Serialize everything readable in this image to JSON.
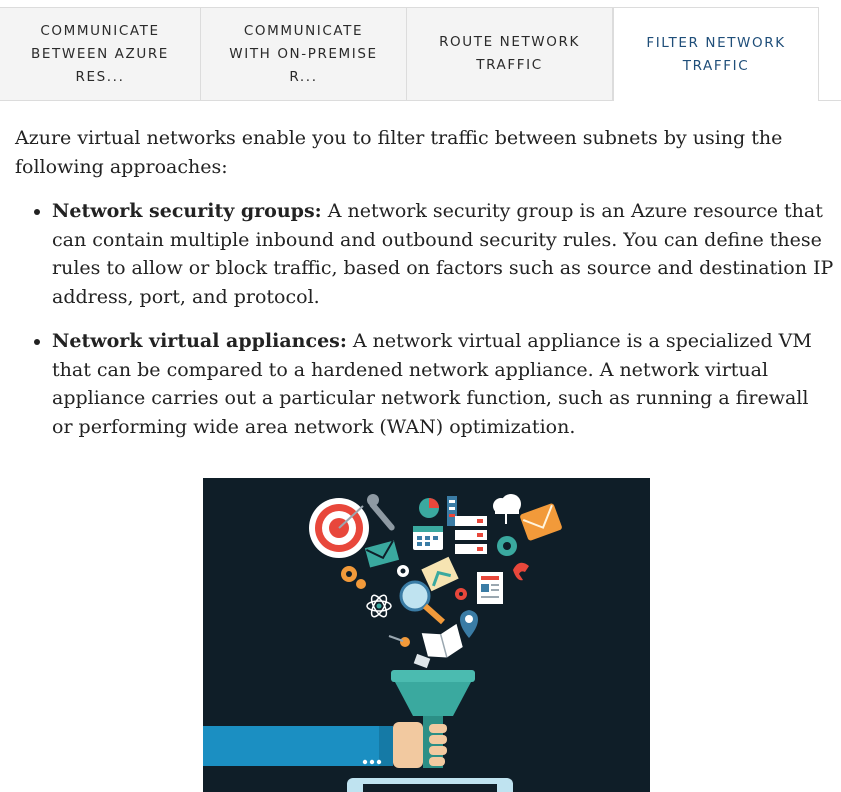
{
  "tabs": [
    {
      "label": "COMMUNICATE\nBETWEEN AZURE\nRES...",
      "active": false
    },
    {
      "label": "COMMUNICATE\nWITH ON-PREMISE\nR...",
      "active": false
    },
    {
      "label": "ROUTE NETWORK\nTRAFFIC",
      "active": false
    },
    {
      "label": "FILTER NETWORK\nTRAFFIC",
      "active": true
    }
  ],
  "content": {
    "intro": "Azure virtual networks enable you to filter traffic between subnets by using the following approaches:",
    "approaches": [
      {
        "term": "Network security groups:",
        "text": " A network security group is an Azure resource that can contain multiple inbound and outbound security rules. You can define these rules to allow or block traffic, based on factors such as source and destination IP address, port, and protocol."
      },
      {
        "term": "Network virtual appliances:",
        "text": " A network virtual appliance is a specialized VM that can be compared to a hardened network appliance. A network virtual appliance carries out a particular network function, such as running a firewall or performing wide area network (WAN) optimization."
      }
    ]
  },
  "figure": {
    "icons": [
      "target-icon",
      "wrench-icon",
      "pie-chart-icon",
      "document-icon",
      "cloud-icon",
      "envelope-icon",
      "calendar-icon",
      "server-icon",
      "gear-icon",
      "phone-icon",
      "magnifier-icon",
      "atom-icon",
      "map-pin-icon",
      "open-book-icon",
      "newspaper-icon",
      "key-icon",
      "funnel-icon",
      "hand-icon"
    ],
    "colors": {
      "background": "#0f1e28",
      "funnel": "#3aa99f",
      "sleeve": "#1b8fc2",
      "accent": "#e8473b"
    }
  }
}
